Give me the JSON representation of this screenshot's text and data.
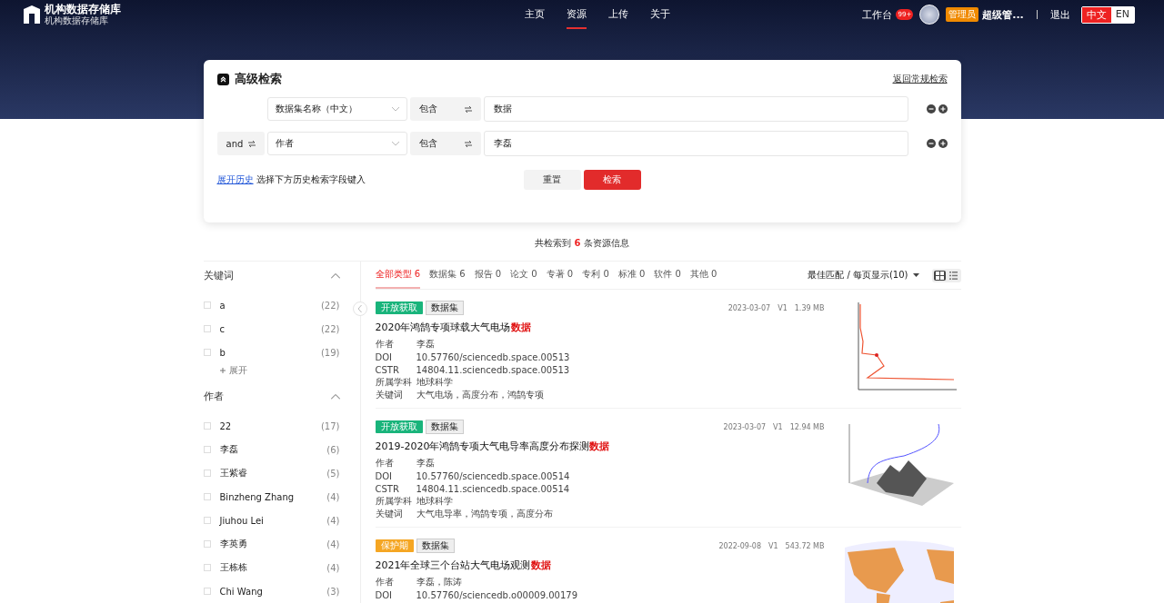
{
  "header": {
    "logo_title": "机构数据存储库",
    "logo_subtitle": "机构数据存储库",
    "nav": [
      {
        "label": "主页",
        "selected": false
      },
      {
        "label": "资源",
        "selected": true
      },
      {
        "label": "上传",
        "selected": false
      },
      {
        "label": "关于",
        "selected": false
      }
    ],
    "workbench": "工作台",
    "notification_badge": "99+",
    "role_badge": "管理员",
    "user_name": "超级管...",
    "logout": "退出",
    "languages": [
      {
        "label": "中文",
        "selected": true
      },
      {
        "label": "EN",
        "selected": false
      }
    ]
  },
  "search_card": {
    "title": "高级检索",
    "back_link": "返回常规检索",
    "rows": [
      {
        "logic": null,
        "field": "数据集名称（中文）",
        "operator": "包含",
        "value": "数据"
      },
      {
        "logic": "and",
        "field": "作者",
        "operator": "包含",
        "value": "李磊"
      }
    ],
    "history_link": "展开历史",
    "history_hint": "选择下方历史检索字段键入",
    "reset": "重置",
    "search": "检索"
  },
  "result_summary": {
    "prefix": "共检索到",
    "count": "6",
    "suffix": "条资源信息"
  },
  "facets": [
    {
      "title": "关键词",
      "expanded": true,
      "more": "展开",
      "items": [
        {
          "label": "a",
          "count": "(22)",
          "checked": false
        },
        {
          "label": "c",
          "count": "(22)",
          "checked": false
        },
        {
          "label": "b",
          "count": "(19)",
          "checked": false
        }
      ]
    },
    {
      "title": "作者",
      "expanded": true,
      "items": [
        {
          "label": "22",
          "count": "(17)",
          "checked": false
        },
        {
          "label": "李磊",
          "count": "(6)",
          "checked": false
        },
        {
          "label": "王紫睿",
          "count": "(5)",
          "checked": false
        },
        {
          "label": "Binzheng Zhang",
          "count": "(4)",
          "checked": false
        },
        {
          "label": "Jiuhou Lei",
          "count": "(4)",
          "checked": false
        },
        {
          "label": "李英勇",
          "count": "(4)",
          "checked": false
        },
        {
          "label": "王栋栋",
          "count": "(4)",
          "checked": false
        },
        {
          "label": "Chi Wang",
          "count": "(3)",
          "checked": false
        }
      ]
    }
  ],
  "type_tabs": [
    {
      "label": "全部类型",
      "count": "6",
      "selected": true
    },
    {
      "label": "数据集",
      "count": "6",
      "selected": false
    },
    {
      "label": "报告",
      "count": "0",
      "selected": false
    },
    {
      "label": "论文",
      "count": "0",
      "selected": false
    },
    {
      "label": "专著",
      "count": "0",
      "selected": false
    },
    {
      "label": "专利",
      "count": "0",
      "selected": false
    },
    {
      "label": "标准",
      "count": "0",
      "selected": false
    },
    {
      "label": "软件",
      "count": "0",
      "selected": false
    },
    {
      "label": "其他",
      "count": "0",
      "selected": false
    }
  ],
  "sort": "最佳匹配 / 每页显示(10)",
  "view_modes": [
    {
      "kind": "grid",
      "selected": true
    },
    {
      "kind": "list",
      "selected": false
    }
  ],
  "results": [
    {
      "kind": "open",
      "access_label": "开放获取",
      "type_label": "数据集",
      "date": "2023-03-07",
      "version": "V1",
      "size": "1.39 MB",
      "title": "2020年鸿鹄专项球载大气电场",
      "highlight": "数据",
      "fields": [
        {
          "label": "作者",
          "value": "李磊"
        },
        {
          "label": "DOI",
          "value": "10.57760/sciencedb.space.00513"
        },
        {
          "label": "CSTR",
          "value": "14804.11.sciencedb.space.00513"
        },
        {
          "label": "所属学科",
          "value": "地球科学"
        },
        {
          "label": "关键词",
          "value": "大气电场，高度分布，鸿鹄专项"
        }
      ]
    },
    {
      "kind": "open",
      "access_label": "开放获取",
      "type_label": "数据集",
      "date": "2023-03-07",
      "version": "V1",
      "size": "12.94 MB",
      "title": "2019-2020年鸿鹄专项大气电导率高度分布探测",
      "highlight": "数据",
      "fields": [
        {
          "label": "作者",
          "value": "李磊"
        },
        {
          "label": "DOI",
          "value": "10.57760/sciencedb.space.00514"
        },
        {
          "label": "CSTR",
          "value": "14804.11.sciencedb.space.00514"
        },
        {
          "label": "所属学科",
          "value": "地球科学"
        },
        {
          "label": "关键词",
          "value": "大气电导率，鸿鹄专项，高度分布"
        }
      ]
    },
    {
      "kind": "embargo",
      "access_label": "保护期",
      "type_label": "数据集",
      "date": "2022-09-08",
      "version": "V1",
      "size": "543.72 MB",
      "title": "2021年全球三个台站大气电场观测",
      "highlight": "数据",
      "fields": [
        {
          "label": "作者",
          "value": "李磊，陈涛"
        },
        {
          "label": "DOI",
          "value": "10.57760/sciencedb.o00009.00179"
        }
      ]
    }
  ]
}
